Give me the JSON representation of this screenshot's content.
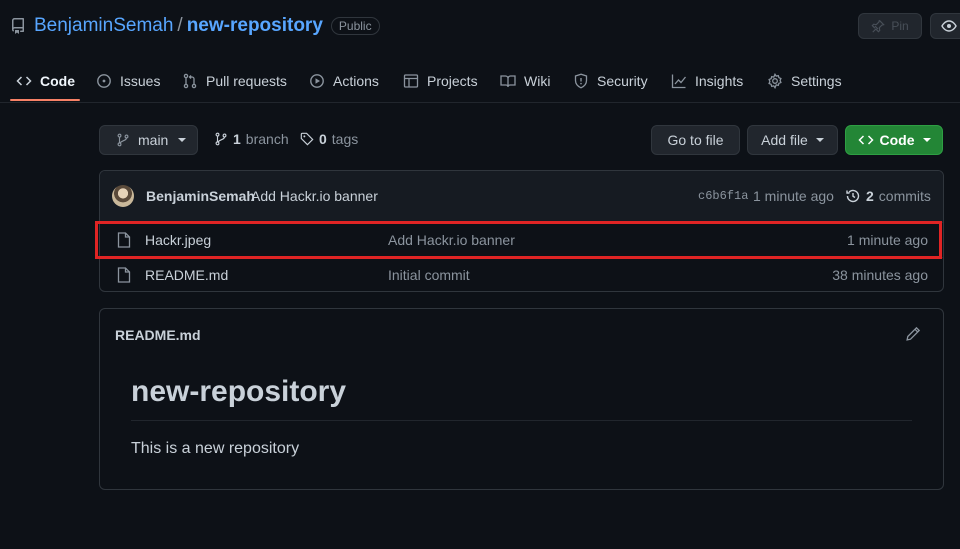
{
  "repo": {
    "owner": "BenjaminSemah",
    "separator": "/",
    "name": "new-repository",
    "visibility": "Public",
    "pin_label": "Pin"
  },
  "tabs": [
    {
      "label": "Code",
      "icon": "code-icon",
      "active": true
    },
    {
      "label": "Issues",
      "icon": "issue-icon"
    },
    {
      "label": "Pull requests",
      "icon": "pull-request-icon"
    },
    {
      "label": "Actions",
      "icon": "play-icon"
    },
    {
      "label": "Projects",
      "icon": "table-icon"
    },
    {
      "label": "Wiki",
      "icon": "book-icon"
    },
    {
      "label": "Security",
      "icon": "shield-icon"
    },
    {
      "label": "Insights",
      "icon": "graph-icon"
    },
    {
      "label": "Settings",
      "icon": "gear-icon"
    }
  ],
  "toolbar": {
    "branch": "main",
    "branch_count": "1",
    "branch_word": "branch",
    "tag_count": "0",
    "tag_word": "tags",
    "go_to_file": "Go to file",
    "add_file": "Add file",
    "code": "Code"
  },
  "latest_commit": {
    "author": "BenjaminSemah",
    "message": "Add Hackr.io banner",
    "sha": "c6b6f1a",
    "time": "1 minute ago",
    "commit_count": "2",
    "commit_word": "commits"
  },
  "files": [
    {
      "name": "Hackr.jpeg",
      "message": "Add Hackr.io banner",
      "time": "1 minute ago",
      "highlighted": true
    },
    {
      "name": "README.md",
      "message": "Initial commit",
      "time": "38 minutes ago"
    }
  ],
  "readme": {
    "filename": "README.md",
    "heading": "new-repository",
    "body": "This is a new repository"
  },
  "colors": {
    "background": "#0d1117",
    "link": "#58a6ff",
    "active_tab_underline": "#f78166",
    "code_button": "#238636",
    "highlight_box": "#e02424"
  }
}
